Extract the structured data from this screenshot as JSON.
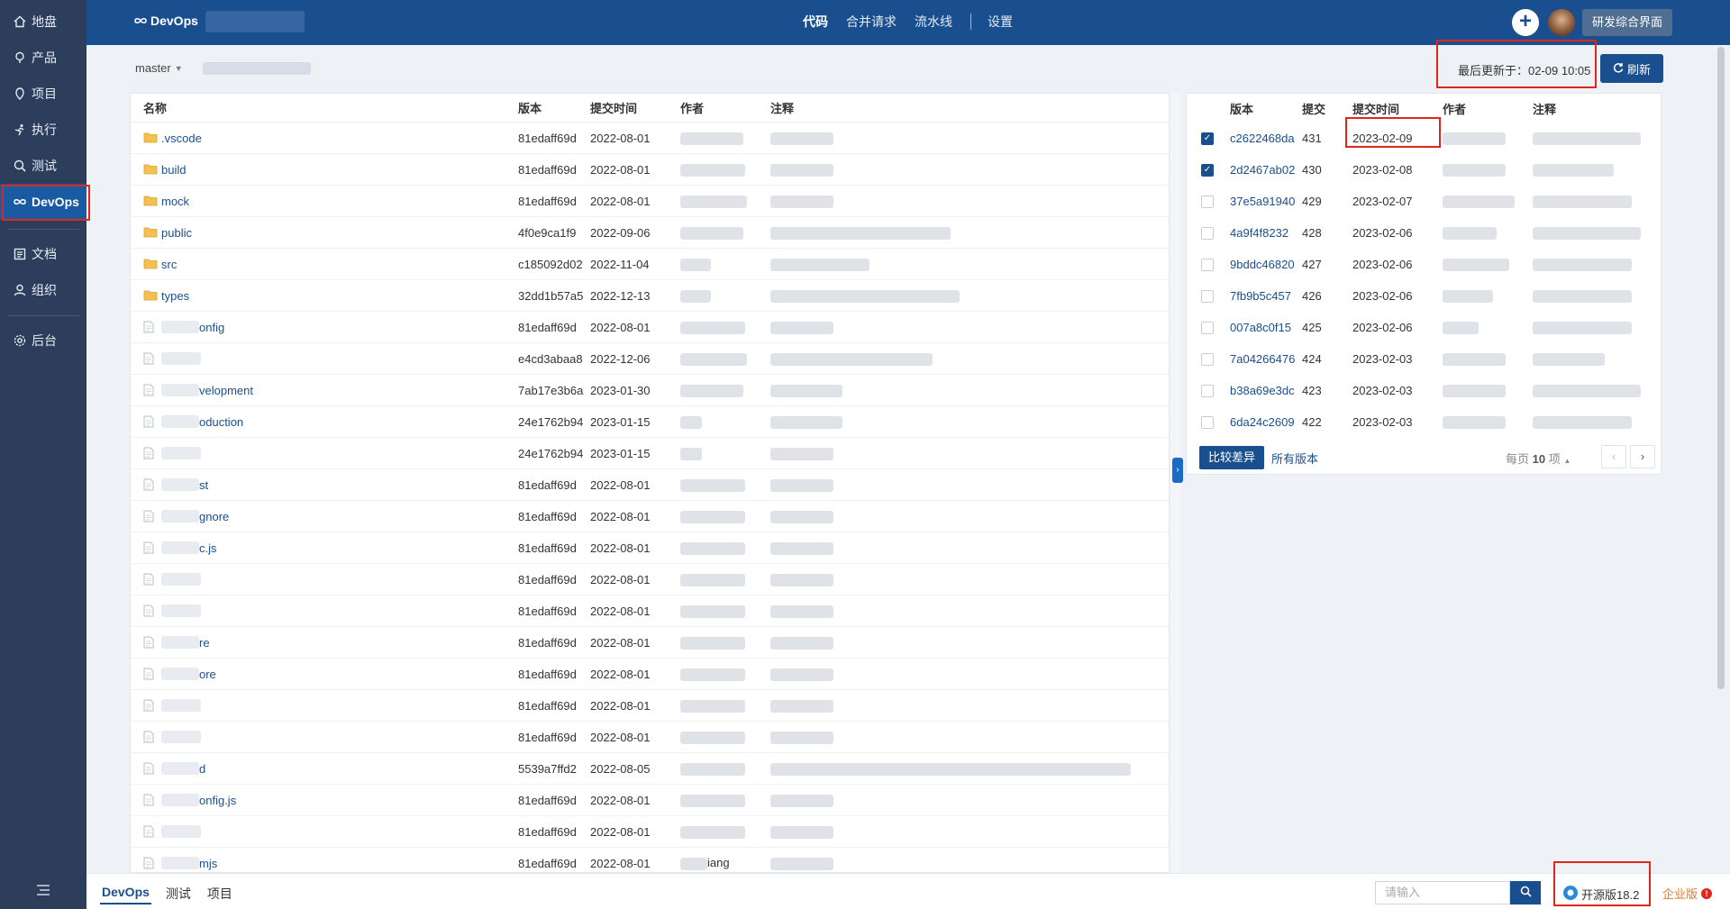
{
  "sidebar": {
    "items": [
      {
        "label": "地盘",
        "icon": "home-icon"
      },
      {
        "label": "产品",
        "icon": "product-icon"
      },
      {
        "label": "项目",
        "icon": "project-icon"
      },
      {
        "label": "执行",
        "icon": "execution-icon"
      },
      {
        "label": "测试",
        "icon": "test-icon"
      },
      {
        "label": "DevOps",
        "icon": "devops-icon"
      },
      {
        "label": "文档",
        "icon": "doc-icon"
      },
      {
        "label": "组织",
        "icon": "org-icon"
      },
      {
        "label": "后台",
        "icon": "admin-icon"
      }
    ],
    "active": "DevOps"
  },
  "header": {
    "logo_label": "DevOps",
    "nav": [
      "代码",
      "合并请求",
      "流水线",
      "设置"
    ],
    "active_nav": "代码",
    "portal_button": "研发综合界面",
    "plus_label": "+"
  },
  "branch": {
    "name": "master"
  },
  "last_updated": "最后更新于：02-09 10:05",
  "refresh_label": "刷新",
  "file_table": {
    "columns": [
      "名称",
      "版本",
      "提交时间",
      "作者",
      "注释"
    ],
    "rows": [
      {
        "name": ".vscode",
        "type": "folder",
        "version": "81edaff69d",
        "time": "2022-08-01"
      },
      {
        "name": "build",
        "type": "folder",
        "version": "81edaff69d",
        "time": "2022-08-01"
      },
      {
        "name": "mock",
        "type": "folder",
        "version": "81edaff69d",
        "time": "2022-08-01"
      },
      {
        "name": "public",
        "type": "folder",
        "version": "4f0e9ca1f9",
        "time": "2022-09-06"
      },
      {
        "name": "src",
        "type": "folder",
        "version": "c185092d02",
        "time": "2022-11-04"
      },
      {
        "name": "types",
        "type": "folder",
        "version": "32dd1b57a5",
        "time": "2022-12-13"
      },
      {
        "name": "onfig",
        "type": "file",
        "version": "81edaff69d",
        "time": "2022-08-01"
      },
      {
        "name": "",
        "type": "file",
        "version": "e4cd3abaa8",
        "time": "2022-12-06"
      },
      {
        "name": "velopment",
        "type": "file",
        "version": "7ab17e3b6a",
        "time": "2023-01-30"
      },
      {
        "name": "oduction",
        "type": "file",
        "version": "24e1762b94",
        "time": "2023-01-15"
      },
      {
        "name": "",
        "type": "file",
        "version": "24e1762b94",
        "time": "2023-01-15"
      },
      {
        "name": "st",
        "type": "file",
        "version": "81edaff69d",
        "time": "2022-08-01"
      },
      {
        "name": "gnore",
        "type": "file",
        "version": "81edaff69d",
        "time": "2022-08-01"
      },
      {
        "name": "c.js",
        "type": "file",
        "version": "81edaff69d",
        "time": "2022-08-01"
      },
      {
        "name": "",
        "type": "file",
        "version": "81edaff69d",
        "time": "2022-08-01"
      },
      {
        "name": "",
        "type": "file",
        "version": "81edaff69d",
        "time": "2022-08-01"
      },
      {
        "name": "re",
        "type": "file",
        "version": "81edaff69d",
        "time": "2022-08-01"
      },
      {
        "name": "ore",
        "type": "file",
        "version": "81edaff69d",
        "time": "2022-08-01"
      },
      {
        "name": "",
        "type": "file",
        "version": "81edaff69d",
        "time": "2022-08-01"
      },
      {
        "name": "",
        "type": "file",
        "version": "81edaff69d",
        "time": "2022-08-01"
      },
      {
        "name": "d",
        "type": "file",
        "version": "5539a7ffd2",
        "time": "2022-08-05"
      },
      {
        "name": "onfig.js",
        "type": "file",
        "version": "81edaff69d",
        "time": "2022-08-01"
      },
      {
        "name": "",
        "type": "file",
        "version": "81edaff69d",
        "time": "2022-08-01"
      },
      {
        "name": "mjs",
        "type": "file",
        "version": "81edaff69d",
        "time": "2022-08-01",
        "author": "iang"
      }
    ]
  },
  "commit_table": {
    "columns": [
      "版本",
      "提交",
      "提交时间",
      "作者",
      "注释"
    ],
    "rows": [
      {
        "version": "c2622468da",
        "num": "431",
        "time": "2023-02-09",
        "checked": true
      },
      {
        "version": "2d2467ab02",
        "num": "430",
        "time": "2023-02-08",
        "checked": true
      },
      {
        "version": "37e5a91940",
        "num": "429",
        "time": "2023-02-07",
        "checked": false
      },
      {
        "version": "4a9f4f8232",
        "num": "428",
        "time": "2023-02-06",
        "checked": false
      },
      {
        "version": "9bddc46820",
        "num": "427",
        "time": "2023-02-06",
        "checked": false
      },
      {
        "version": "7fb9b5c457",
        "num": "426",
        "time": "2023-02-06",
        "checked": false
      },
      {
        "version": "007a8c0f15",
        "num": "425",
        "time": "2023-02-06",
        "checked": false
      },
      {
        "version": "7a04266476",
        "num": "424",
        "time": "2023-02-03",
        "checked": false
      },
      {
        "version": "b38a69e3dc",
        "num": "423",
        "time": "2023-02-03",
        "checked": false
      },
      {
        "version": "6da24c2609",
        "num": "422",
        "time": "2023-02-03",
        "checked": false
      }
    ],
    "compare_button": "比较差异",
    "all_versions_link": "所有版本",
    "page_size_label": "每页",
    "page_size_value": "10",
    "page_size_unit": "项",
    "prev": "‹",
    "next": "›"
  },
  "bottom": {
    "tabs": [
      "DevOps",
      "测试",
      "项目"
    ],
    "active_tab": "DevOps",
    "search_placeholder": "请输入",
    "version_label": "开源版18.2",
    "enterprise_label": "企业版"
  },
  "colors": {
    "header_bg": "#1a4f8f",
    "sidebar_bg": "#2c3e5c",
    "sidebar_active": "#1a5aa3",
    "link": "#1a4f8f",
    "highlight_box": "#e0261a"
  }
}
